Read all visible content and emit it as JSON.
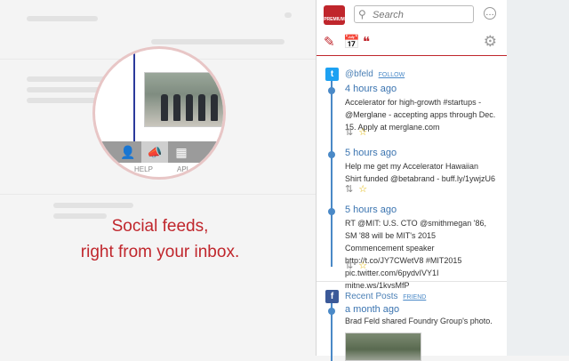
{
  "tagline": {
    "line1": "Social feeds,",
    "line2": "right from your inbox."
  },
  "zoom": {
    "help_label": "HELP",
    "api_label": "API"
  },
  "sidebar": {
    "logo_text": "PREMIUM",
    "search": {
      "placeholder": "Search"
    },
    "menu_symbol": "…",
    "feeds": [
      {
        "network": "twitter",
        "account": "@bfeld",
        "action": "FOLLOW",
        "posts": [
          {
            "time": "4 hours ago",
            "text": "Accelerator for high-growth #startups - @Merglane - accepting apps through Dec. 15. Apply at merglane.com"
          },
          {
            "time": "5 hours ago",
            "text": "Help me get my Accelerator Hawaiian Shirt funded @betabrand - buff.ly/1ywjzU6"
          },
          {
            "time": "5 hours ago",
            "text": "RT @MIT: U.S. CTO @smithmegan '86, SM '88 will be MIT's 2015 Commencement speaker http://t.co/JY7CWetV8 #MIT2015 pic.twitter.com/6pydvIVY1I mitne.ws/1kvsMfP"
          }
        ]
      },
      {
        "network": "facebook",
        "account": "Recent Posts",
        "action": "FRIEND",
        "posts": [
          {
            "time": "a month ago",
            "text": "Brad Feld shared Foundry Group's photo."
          }
        ]
      }
    ]
  },
  "colors": {
    "brand": "#c0262c",
    "link": "#4a89c7",
    "twitter": "#1da1f2",
    "facebook": "#3b5998"
  }
}
